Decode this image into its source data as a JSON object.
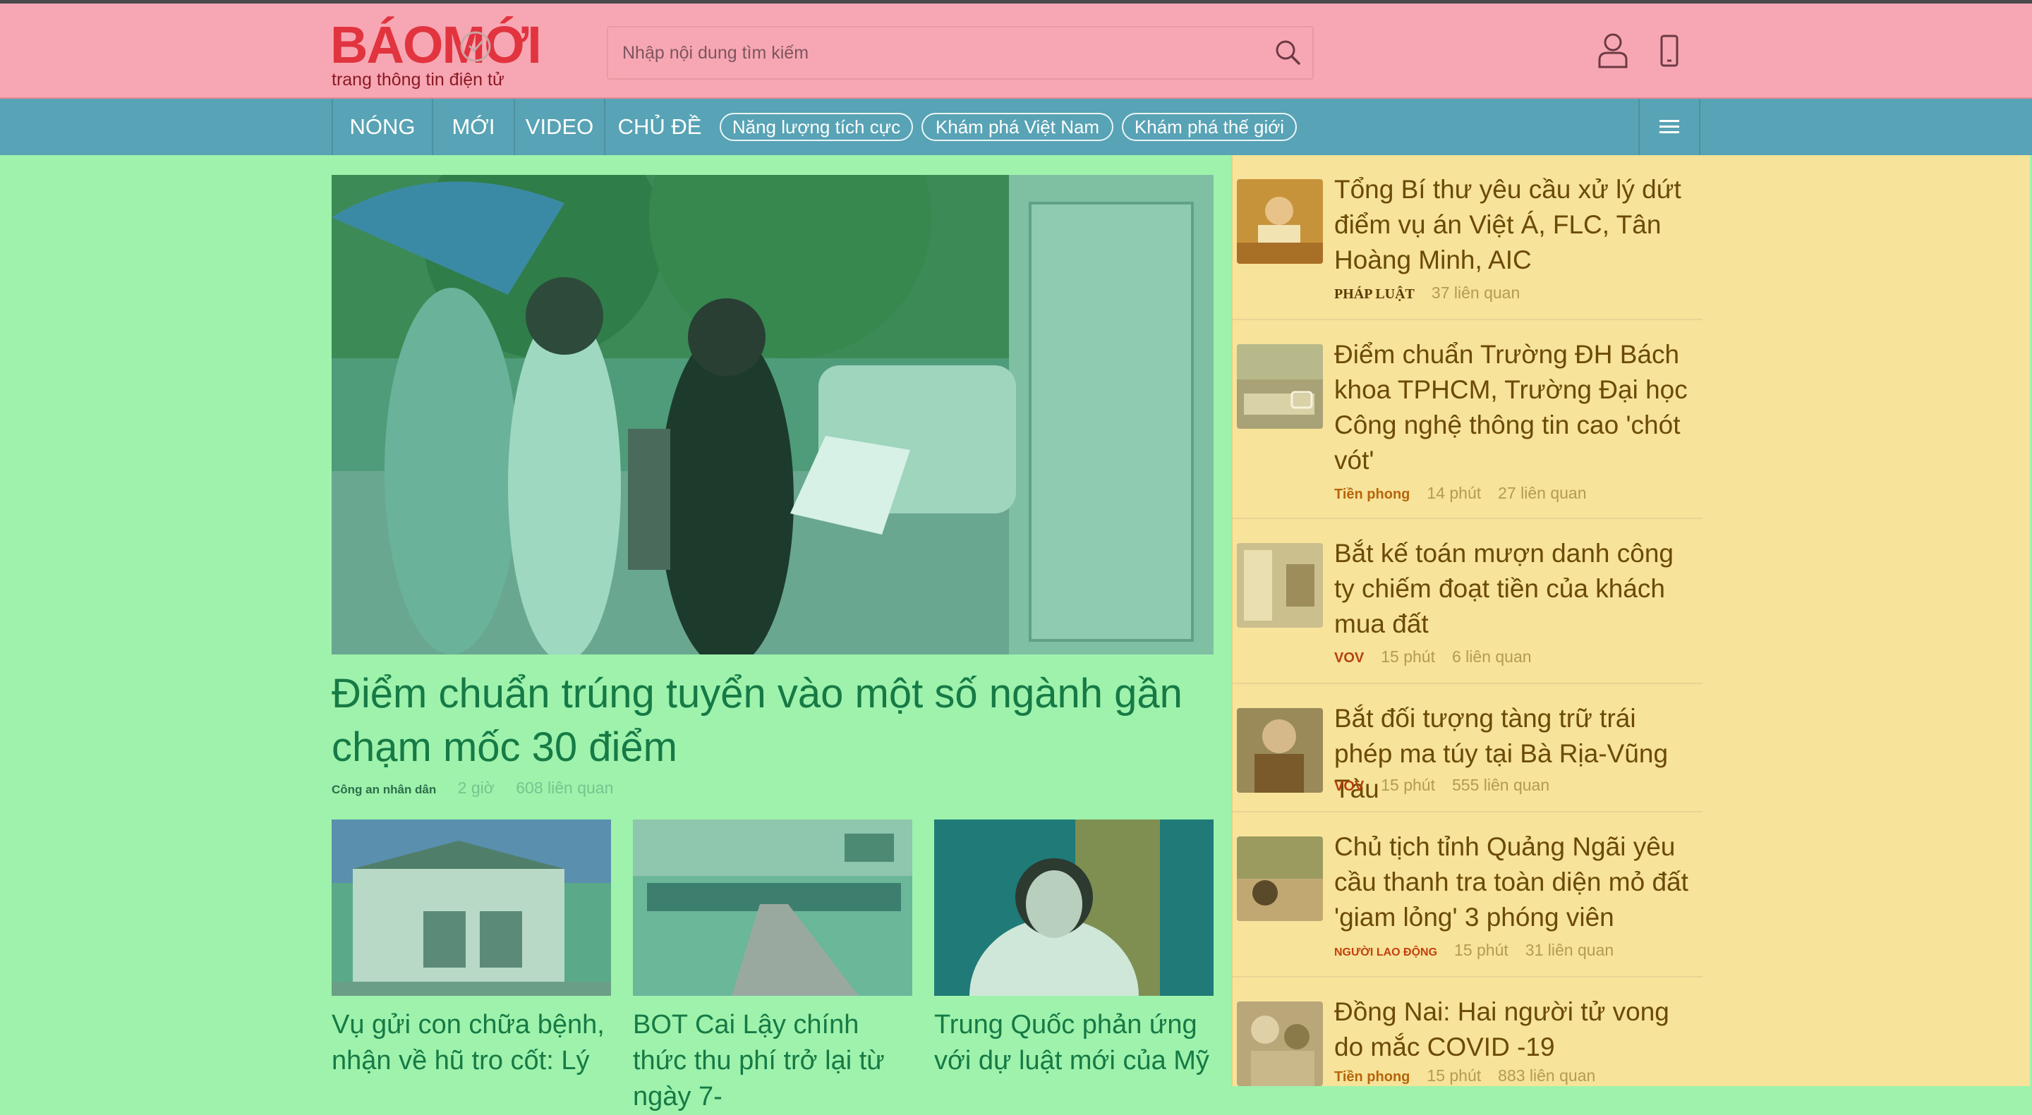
{
  "header": {
    "logo_text": "BÁOMỚI",
    "tagline": "trang thông tin điện tử",
    "search_placeholder": "Nhập nội dung tìm kiếm"
  },
  "nav": {
    "items": [
      "NÓNG",
      "MỚI",
      "VIDEO",
      "CHỦ ĐỀ"
    ],
    "pills": [
      "Năng lượng tích cực",
      "Khám phá Việt Nam",
      "Khám phá thế giới"
    ]
  },
  "hero": {
    "title": "Điểm chuẩn trúng tuyển vào một số ngành gần chạm mốc 30 điểm",
    "source": "Công an nhân dân",
    "time": "2 giờ",
    "related": "608 liên quan"
  },
  "cards": [
    {
      "title": "Vụ gửi con chữa bệnh, nhận về hũ tro cốt: Lý"
    },
    {
      "title": "BOT Cai Lậy chính thức thu phí trở lại từ ngày 7-"
    },
    {
      "title": "Trung Quốc phản ứng với dự luật mới của Mỹ"
    }
  ],
  "sidebar": [
    {
      "title": "Tổng Bí thư yêu cầu xử lý dứt điểm vụ án Việt Á, FLC, Tân Hoàng Minh, AIC",
      "source": "PHÁP LUẬT",
      "time": "",
      "related": "37 liên quan"
    },
    {
      "title": "Điểm chuẩn Trường ĐH Bách khoa TPHCM, Trường Đại học Công nghệ thông tin cao 'chót vót'",
      "source": "Tiền phong",
      "time": "14 phút",
      "related": "27 liên quan"
    },
    {
      "title": "Bắt kế toán mượn danh công ty chiếm đoạt tiền của khách mua đất",
      "source": "VOV",
      "time": "15 phút",
      "related": "6 liên quan"
    },
    {
      "title": "Bắt đối tượng tàng trữ trái phép ma túy tại Bà Rịa-Vũng Tàu",
      "source": "VOV",
      "time": "15 phút",
      "related": "555 liên quan"
    },
    {
      "title": "Chủ tịch tỉnh Quảng Ngãi yêu cầu thanh tra toàn diện mỏ đất 'giam lỏng' 3 phóng viên",
      "source": "NGƯỜI LAO ĐỘNG",
      "time": "15 phút",
      "related": "31 liên quan"
    },
    {
      "title": "Đồng Nai: Hai người tử vong do mắc COVID -19",
      "source": "Tiền phong",
      "time": "15 phút",
      "related": "883 liên quan"
    }
  ]
}
